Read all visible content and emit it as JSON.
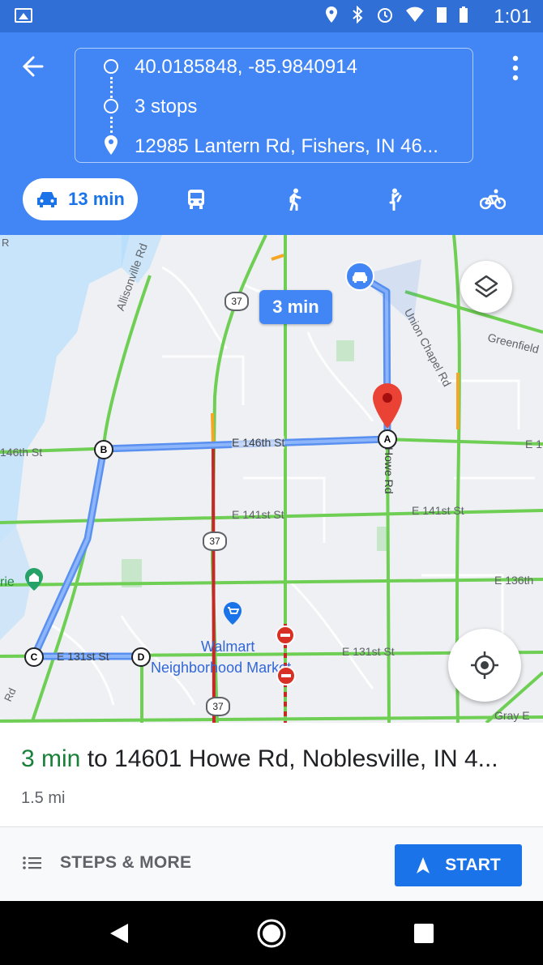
{
  "status_bar": {
    "time": "1:01"
  },
  "route": {
    "origin": "40.0185848, -85.9840914",
    "stops": "3 stops",
    "destination": "12985 Lantern Rd, Fishers, IN 46..."
  },
  "modes": {
    "active_label": "13 min",
    "items": [
      "drive",
      "transit",
      "walk",
      "ride-share",
      "bike"
    ]
  },
  "map": {
    "duration_bubble": "3 min",
    "roads": {
      "allisonville": "Allisonville Rd",
      "union_chapel": "Union Chapel Rd",
      "greenfield": "Greenfield",
      "e146_left": "146th St",
      "e146_mid": "E 146th St",
      "e146_right": "E 1",
      "howe": "Howe Rd",
      "e141_mid": "E 141st St",
      "e141_right": "E 141st St",
      "e136": "E 136th",
      "e131_left": "E 131st St",
      "e131_right": "E 131st St",
      "gray": "Gray E",
      "rie": "rie",
      "rd_left": "Rd",
      "r_top": "R"
    },
    "route_shields": [
      "37",
      "37",
      "37"
    ],
    "waypoints": [
      "A",
      "B",
      "C",
      "D"
    ],
    "poi": {
      "walmart_1": "Walmart",
      "walmart_2": "Neighborhood Market"
    }
  },
  "summary": {
    "eta": "3 min",
    "to": "to 14601 Howe Rd, Noblesville, IN 4...",
    "distance": "1.5 mi"
  },
  "actions": {
    "steps": "STEPS & MORE",
    "start": "START"
  },
  "colors": {
    "header": "#4285f4",
    "status_bar": "#2f6fd6",
    "route": "#4f8ef7",
    "accent": "#1a73e8",
    "eta": "#188038"
  }
}
